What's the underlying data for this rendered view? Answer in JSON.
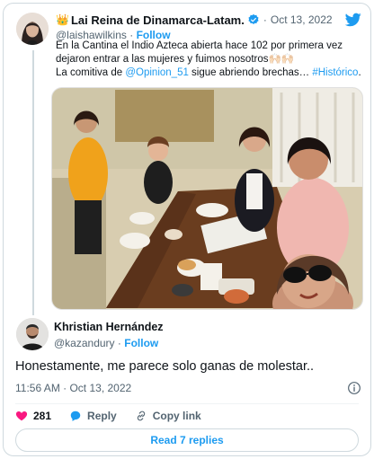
{
  "tweet": {
    "name_emoji": "👑",
    "name": "Lai Reina de Dinamarca-Latam.",
    "date": "Oct 13, 2022",
    "handle": "@laishawilkins",
    "follow_label": "Follow",
    "text_line1": "En la Cantina el Indio Azteca abierta hace 102 por primera vez",
    "text_line2": "dejaron entrar a las mujeres y fuimos nosotros🙌🏻🙌🏻",
    "text_line3_prefix": "La comitiva de ",
    "text_line3_mention": "@Opinion_51",
    "text_line3_middle": " sigue abriendo brechas… ",
    "text_line3_hashtag": "#Histórico",
    "text_line3_suffix": "."
  },
  "reply": {
    "name": "Khristian Hernández",
    "handle": "@kazandury",
    "follow_label": "Follow",
    "text": "Honestamente, me parece solo ganas de molestar..",
    "meta": "11:56 AM · Oct 13, 2022"
  },
  "actions": {
    "like_count": "281",
    "reply_label": "Reply",
    "copy_label": "Copy link"
  },
  "read_replies_label": "Read 7 replies",
  "colors": {
    "accent": "#1d9bf0",
    "like": "#f91880",
    "muted": "#536471"
  },
  "icons": [
    "crown-emoji",
    "verified-badge-icon",
    "twitter-bird-icon",
    "info-icon",
    "heart-icon",
    "reply-bubble-icon",
    "link-icon"
  ]
}
